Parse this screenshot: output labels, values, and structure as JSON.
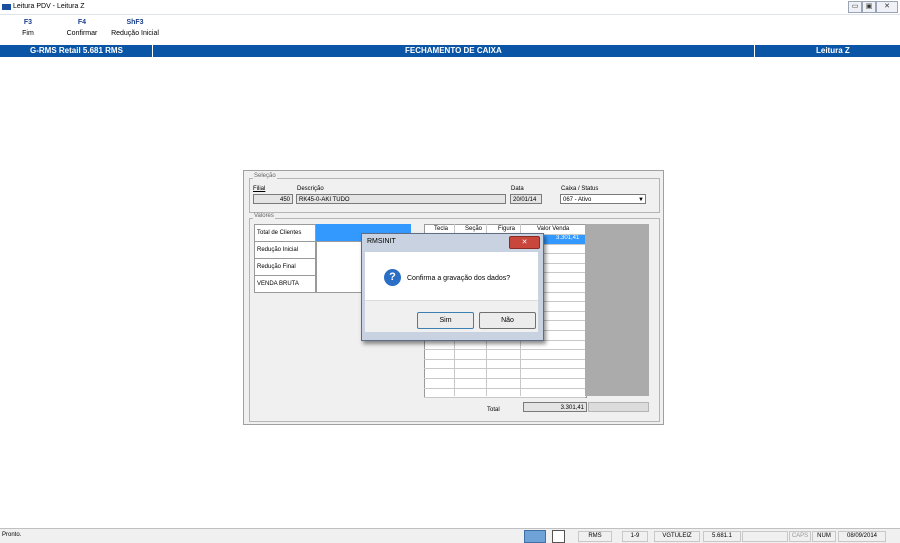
{
  "window": {
    "title": "Leitura PDV - Leitura Z",
    "controls": [
      "▭",
      "▣",
      "✕"
    ]
  },
  "function_keys": [
    {
      "key": "F3",
      "label": "Fim"
    },
    {
      "key": "F4",
      "label": "Confirmar"
    },
    {
      "key": "ShF3",
      "label": "Redução Inicial"
    }
  ],
  "header": {
    "left": "G-RMS Retail 5.681 RMS",
    "center": "FECHAMENTO DE CAIXA",
    "right": "Leitura Z"
  },
  "selecao": {
    "legend": "Seleção",
    "filial_label": "Filial",
    "filial_value": "450",
    "descricao_label": "Descrição",
    "descricao_value": "RK45-0-AKI TUDO",
    "data_label": "Data",
    "data_value": "20/01/14",
    "caixa_label": "Caixa / Status",
    "caixa_value": "067  - Ativo"
  },
  "valores": {
    "legend": "Valores",
    "rows": [
      "Total de Clientes",
      "Redução Inicial",
      "Redução Final",
      "VENDA BRUTA"
    ],
    "grid_headers": [
      "Tecla",
      "Seção",
      "Figura",
      "Valor Venda"
    ],
    "grid_first_value": "3.301,41",
    "total_label": "Total",
    "total_value": "3.301,41"
  },
  "dialog": {
    "title": "RMSINIT",
    "message": "Confirma a gravação dos dados?",
    "yes": "Sim",
    "no": "Não"
  },
  "statusbar": {
    "status": "Pronto.",
    "fields": [
      "RMS",
      "1-9",
      "VGTULEIZ",
      "5.681.1",
      "",
      "CAPS",
      "NUM",
      "08/09/2014"
    ]
  },
  "colors": {
    "accent": "#0a55a6",
    "selection": "#3399ff",
    "question_icon": "#2a6ec5"
  }
}
